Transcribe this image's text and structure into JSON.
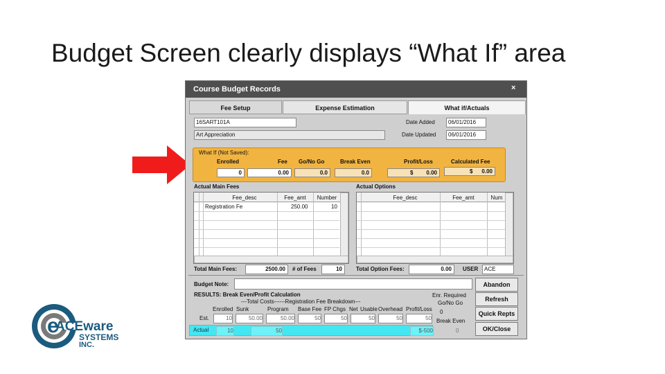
{
  "slide": {
    "title": "Budget Screen clearly displays “What If” area"
  },
  "window": {
    "title": "Course Budget Records",
    "close": "×"
  },
  "tabs": [
    {
      "label": "Fee Setup"
    },
    {
      "label": "Expense Estimation"
    },
    {
      "label": "What if/Actuals"
    }
  ],
  "course": {
    "code": "16SART101A",
    "name": "Art Appreciation",
    "date_added_label": "Date Added",
    "date_added": "06/01/2016",
    "date_updated_label": "Date Updated",
    "date_updated": "06/01/2016"
  },
  "whatif": {
    "heading": "What If (Not Saved):",
    "columns": [
      "Enrolled",
      "Fee",
      "Go/No Go",
      "Break Even",
      "Profit/Loss",
      "Calculated Fee"
    ],
    "values": [
      "0",
      "0.00",
      "0.0",
      "0.0",
      "0.00",
      "0.00"
    ],
    "currency": "$"
  },
  "main_fees": {
    "label": "Actual Main Fees",
    "columns": [
      "Fee_desc",
      "Fee_amt",
      "Number"
    ],
    "rows": [
      {
        "desc": "Registration Fe",
        "amt": "250.00",
        "number": "10"
      }
    ],
    "total_label": "Total Main Fees:",
    "total": "2500.00",
    "num_fees_label": "# of Fees",
    "num_fees": "10"
  },
  "options": {
    "label": "Actual Options",
    "columns": [
      "Fee_desc",
      "Fee_amt",
      "Num"
    ],
    "total_label": "Total Option Fees:",
    "total": "0.00",
    "user_label": "USER",
    "user": "ACE"
  },
  "budget_note": {
    "label": "Budget Note:",
    "value": ""
  },
  "results": {
    "heading": "RESULTS: Break Even/Profit Calculation",
    "subheading": "---Total Costs------Registration Fee Breakdown---",
    "enr_required": "Enr. Required",
    "columns": [
      "Enrolled",
      "Sunk",
      "Program",
      "Base Fee",
      "FP Chgs",
      "Net",
      "Usable",
      "Overhead",
      "Profit/Loss"
    ],
    "go_nogo": "Go/No Go",
    "break_even": "Break Even",
    "est_label": "Est.",
    "est_values": [
      "10",
      "50.00",
      "50.00",
      "50",
      "50",
      "50",
      "50",
      "50"
    ],
    "est_go": "0",
    "actual_label": "Actual",
    "actual_values": [
      "10",
      "50",
      "$-500"
    ],
    "actual_go": "0"
  },
  "buttons": {
    "abandon": "Abandon",
    "refresh": "Refresh",
    "quick_repts": "Quick Repts",
    "ok_close": "OK/Close"
  },
  "logo": {
    "letter": "e",
    "line1": "ACEware",
    "line2": "SYSTEMS",
    "line3": "INC.",
    "color_blue": "#1b5b7e",
    "color_gray": "#7a7a7a"
  },
  "colors": {
    "whatif_bg": "#f2b441",
    "actual_bg": "#42e7f2",
    "arrow": "#f01c1c",
    "titlebar": "#4f4f4f"
  }
}
